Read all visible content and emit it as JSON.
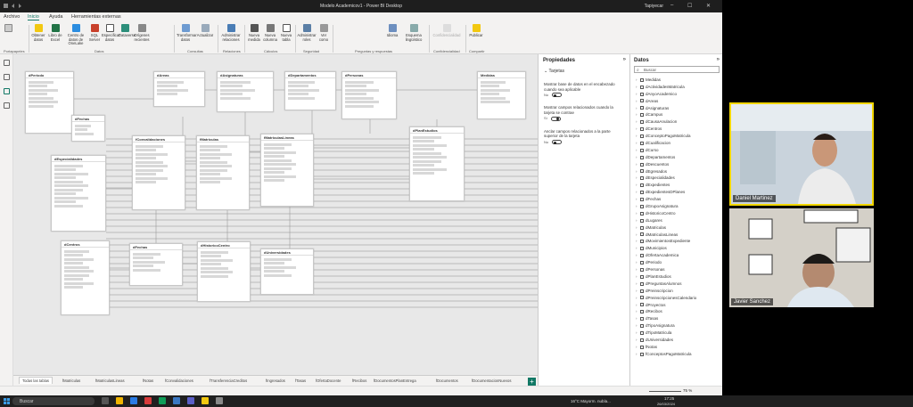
{
  "window": {
    "title": "Modelo Academicov1 - Power BI Desktop",
    "user": "Tapiyecar"
  },
  "menu_tabs": [
    {
      "label": "Archivo"
    },
    {
      "label": "Inicio"
    },
    {
      "label": "Ayuda"
    },
    {
      "label": "Herramientas externas"
    }
  ],
  "ribbon": {
    "buttons": [
      {
        "label": "Obtener datos"
      },
      {
        "label": "Libro de Excel"
      },
      {
        "label": "Centro de datos de OneLake"
      },
      {
        "label": "SQL Server"
      },
      {
        "label": "Especificar datos"
      },
      {
        "label": "Dataverse"
      },
      {
        "label": "Orígenes recientes"
      },
      {
        "label": "Transformar datos"
      },
      {
        "label": "Actualizar"
      },
      {
        "label": "Administrar relaciones"
      },
      {
        "label": "Nueva medida"
      },
      {
        "label": "Nueva columna"
      },
      {
        "label": "Nueva tabla"
      },
      {
        "label": "Administrar roles"
      },
      {
        "label": "Ver como"
      },
      {
        "label": "Idioma"
      },
      {
        "label": "Esquema lingüístico"
      },
      {
        "label": "Confidencialidad"
      },
      {
        "label": "Publicar"
      }
    ],
    "groups": [
      {
        "label": "Portapapeles"
      },
      {
        "label": "Datos"
      },
      {
        "label": "Consultas"
      },
      {
        "label": "Relaciones"
      },
      {
        "label": "Cálculos"
      },
      {
        "label": "Seguridad"
      },
      {
        "label": "Preguntas y respuestas"
      },
      {
        "label": "Confidencialidad"
      },
      {
        "label": "Compartir"
      }
    ]
  },
  "model_tables": [
    {
      "name": "dPeriodo"
    },
    {
      "name": "dAreas"
    },
    {
      "name": "dAsignaturas"
    },
    {
      "name": "dDepartamentos"
    },
    {
      "name": "dPersonas"
    },
    {
      "name": "Medidas"
    },
    {
      "name": "dFechas"
    },
    {
      "name": "dEspecialidades"
    },
    {
      "name": "fConvalidaciones"
    },
    {
      "name": "fMatriculas"
    },
    {
      "name": "fMatriculasLineas"
    },
    {
      "name": "dPlanEstudios"
    },
    {
      "name": "dCentros"
    },
    {
      "name": "dFechas"
    },
    {
      "name": "dHistoricoCentro"
    },
    {
      "name": "dUniversidades"
    }
  ],
  "bottom_tabs": [
    {
      "label": "Todas las tablas"
    },
    {
      "label": "fMatriculas"
    },
    {
      "label": "fMatriculasLineas"
    },
    {
      "label": "fNotas"
    },
    {
      "label": "fConvalidaciones"
    },
    {
      "label": "fTransferenciaCreditos"
    },
    {
      "label": "fIngresados"
    },
    {
      "label": "fTasas"
    },
    {
      "label": "fOfertaDocente"
    },
    {
      "label": "fRecibos"
    },
    {
      "label": "fDocumentosPlanEntrega"
    },
    {
      "label": "fDocumentos"
    },
    {
      "label": "fDocumentacionNuevos"
    }
  ],
  "properties": {
    "header": "Propiedades",
    "section": "Tarjetas",
    "options": [
      {
        "text": "Mostrar base de datos en el encabezado cuando sea aplicable",
        "state": "No"
      },
      {
        "text": "Mostrar campos relacionados cuando la tarjeta se contrae",
        "state": "Sí"
      },
      {
        "text": "Anclar campos relacionados a la parte superior de la tarjeta",
        "state": "No"
      }
    ]
  },
  "data_pane": {
    "header": "Datos",
    "search_placeholder": "Buscar",
    "items": [
      {
        "label": "Medidas"
      },
      {
        "label": "dActividadesMatricula"
      },
      {
        "label": "dAnyoAcademico"
      },
      {
        "label": "dAreas"
      },
      {
        "label": "dAsignaturas"
      },
      {
        "label": "dCampus"
      },
      {
        "label": "dCausaAnulacion"
      },
      {
        "label": "dCentros"
      },
      {
        "label": "dConceptoPagoMatricula"
      },
      {
        "label": "dCualificacion"
      },
      {
        "label": "dCurso"
      },
      {
        "label": "dDepartamentos"
      },
      {
        "label": "dDescuentos"
      },
      {
        "label": "dEgresados"
      },
      {
        "label": "dEspecialidades"
      },
      {
        "label": "dExpedientes"
      },
      {
        "label": "dExpedientesDPlanes"
      },
      {
        "label": "dFechas"
      },
      {
        "label": "dGrupoAsignatura"
      },
      {
        "label": "dHistoricoCentro"
      },
      {
        "label": "dLugares"
      },
      {
        "label": "dMatriculas"
      },
      {
        "label": "dMatriculasLineas"
      },
      {
        "label": "dMovimientosExpediente"
      },
      {
        "label": "dMunicipios"
      },
      {
        "label": "dOfertaAcademica"
      },
      {
        "label": "dPeriodo"
      },
      {
        "label": "dPersonas"
      },
      {
        "label": "dPlanEstudios"
      },
      {
        "label": "dPreguntasAlumnos"
      },
      {
        "label": "dPreinscripcion"
      },
      {
        "label": "dPreinscripcionesCalendario"
      },
      {
        "label": "dProyectos"
      },
      {
        "label": "dRecibos"
      },
      {
        "label": "dTasas"
      },
      {
        "label": "dTipoAsignatura"
      },
      {
        "label": "dTipoMatricula"
      },
      {
        "label": "dUniversidades"
      },
      {
        "label": "fNotas"
      },
      {
        "label": "fConceptosPagoMatricula"
      }
    ]
  },
  "status": {
    "zoom": "75 %"
  },
  "taskbar": {
    "search": "Buscar",
    "weather": "16°C  Mayorm. nubla...",
    "time": "17:25",
    "date": "26/03/2024"
  },
  "participants": [
    {
      "name": "Daniel Martinez"
    },
    {
      "name": "Javier Sanchez"
    }
  ],
  "colors": {
    "accent": "#117865",
    "active_speaker": "#f2d600"
  }
}
